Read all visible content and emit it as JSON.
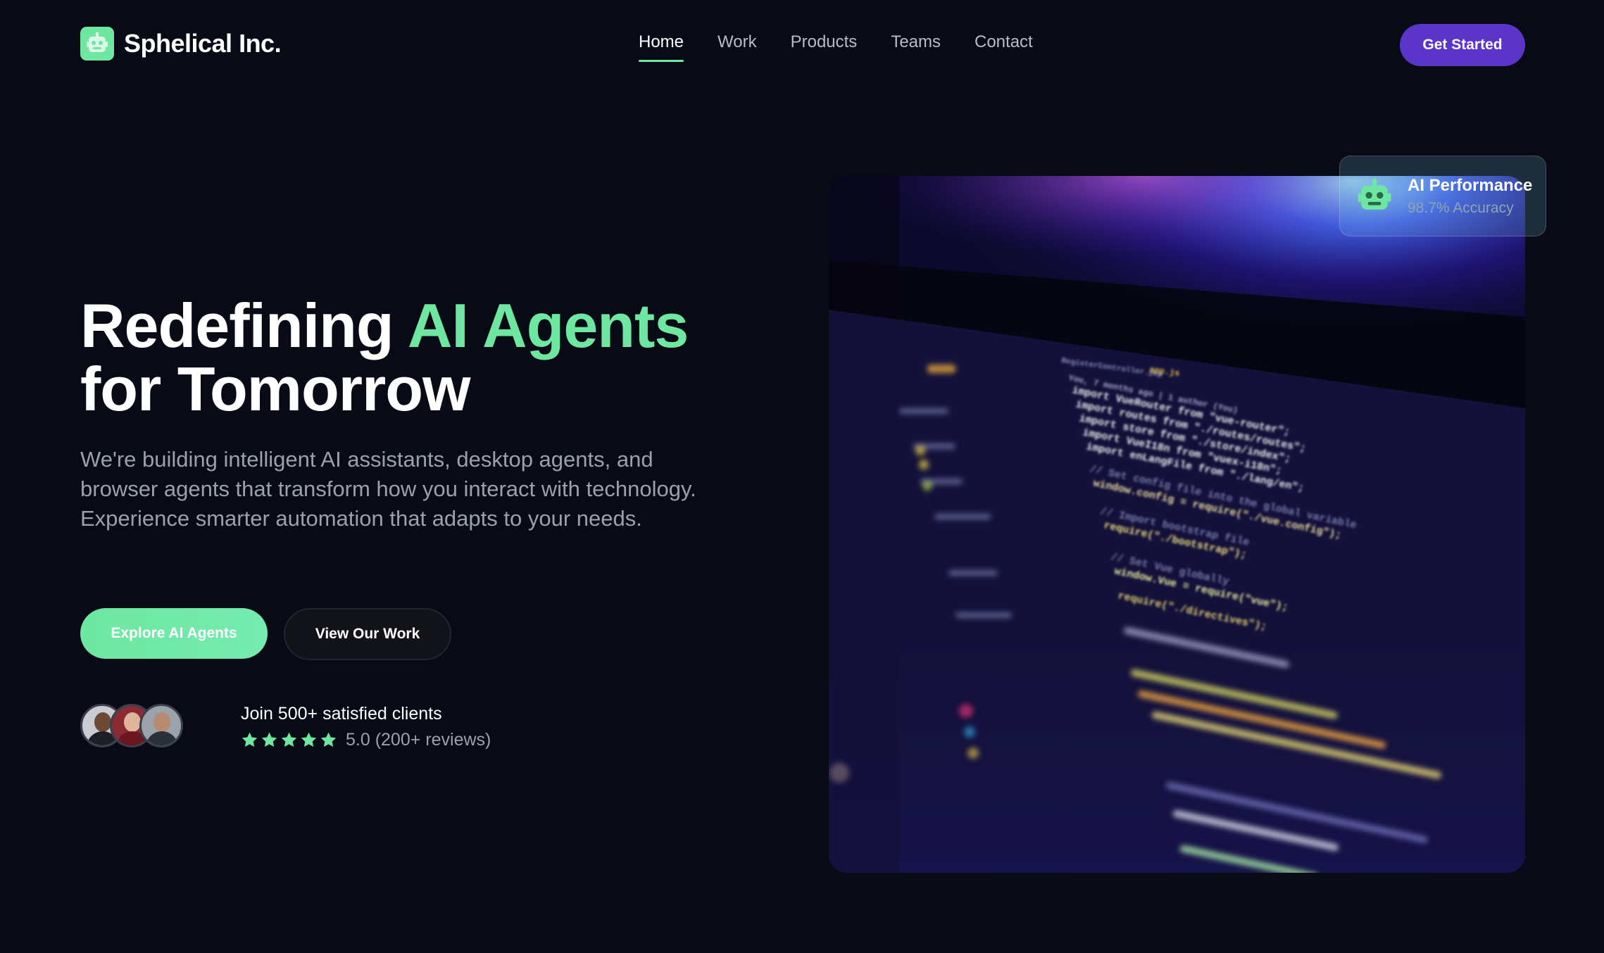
{
  "brand": {
    "name": "Sphelical Inc.",
    "logo_icon": "robot-icon",
    "accent": "#6ee7a0"
  },
  "nav": {
    "links": [
      {
        "label": "Home",
        "active": true
      },
      {
        "label": "Work",
        "active": false
      },
      {
        "label": "Products",
        "active": false
      },
      {
        "label": "Teams",
        "active": false
      },
      {
        "label": "Contact",
        "active": false
      }
    ],
    "cta_label": "Get Started",
    "cta_color": "#5b35c9"
  },
  "hero": {
    "title_part1": "Redefining ",
    "title_accent": "AI Agents",
    "title_part2": "for Tomorrow",
    "subtitle": "We're building intelligent AI assistants, desktop agents, and browser agents that transform how you interact with technology. Experience smarter automation that adapts to your needs.",
    "primary_button": "Explore AI Agents",
    "secondary_button": "View Our Work"
  },
  "social_proof": {
    "text": "Join 500+ satisfied clients",
    "rating_text": "5.0 (200+ reviews)",
    "stars": 5,
    "avatars": [
      "avatar-1",
      "avatar-2",
      "avatar-3"
    ]
  },
  "performance_card": {
    "icon": "robot-icon",
    "title": "AI Performance",
    "subtitle": "98.7% Accuracy"
  },
  "code_screen": {
    "file_tab": "RegisterController.php",
    "file_tab_2": "app.js",
    "blame": "You, 7 months ago | 1 author (You)",
    "lines": [
      "import VueRouter from \"vue-router\";",
      "import routes from \"./routes/routes\";",
      "import store from \"./store/index\";",
      "import VueI18n from \"vuex-i18n\";",
      "import enLangFile from \"./lang/en\";",
      "// Set config file into the global variable",
      "window.config = require(\"./vue.config\");",
      "// Import bootstrap file",
      "require(\"./bootstrap\");",
      "// Set Vue globally",
      "window.Vue = require(\"vue\");",
      "require(\"./directives\");"
    ]
  }
}
